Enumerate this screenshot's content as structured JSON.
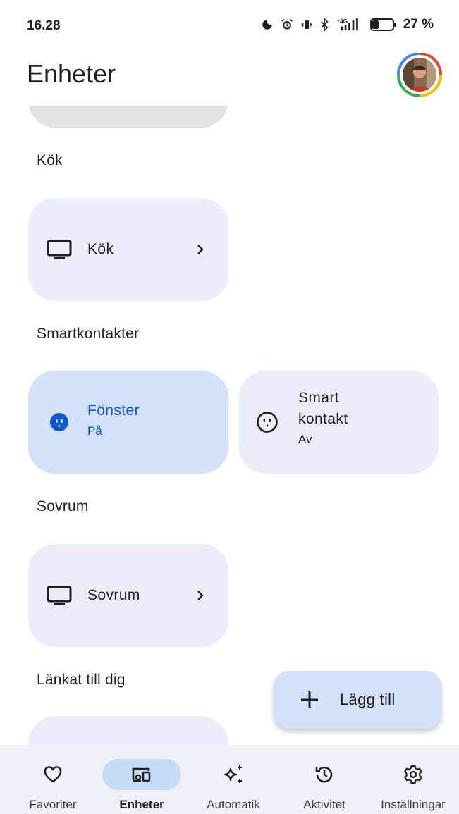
{
  "status_bar": {
    "time": "16.28",
    "battery_percent": "27 %",
    "icons": [
      "moon-icon",
      "alarm-icon",
      "vibrate-icon",
      "bluetooth-icon",
      "signal-4g-icon",
      "battery-icon"
    ]
  },
  "header": {
    "title": "Enheter"
  },
  "sections": {
    "kitchen": {
      "title": "Kök",
      "card_label": "Kök"
    },
    "smart_plugs": {
      "title": "Smartkontakter",
      "plug1_name": "Fönster",
      "plug1_state": "På",
      "plug2_name_line1": "Smart",
      "plug2_name_line2": "kontakt",
      "plug2_state": "Av"
    },
    "bedroom": {
      "title": "Sovrum",
      "card_label": "Sovrum"
    },
    "linked": {
      "title": "Länkat till dig"
    }
  },
  "fab": {
    "label": "Lägg till"
  },
  "nav": {
    "items": [
      {
        "label": "Favoriter",
        "icon": "heart-icon",
        "active": false
      },
      {
        "label": "Enheter",
        "icon": "devices-icon",
        "active": true
      },
      {
        "label": "Automatik",
        "icon": "sparkle-icon",
        "active": false
      },
      {
        "label": "Aktivitet",
        "icon": "history-icon",
        "active": false
      },
      {
        "label": "Inställningar",
        "icon": "gear-icon",
        "active": false
      }
    ]
  },
  "colors": {
    "accent": "#0b57d0",
    "card_bg": "#e9eef8",
    "card_active_bg": "#d3e1fb",
    "nav_bg": "#eef2f8",
    "nav_active_pill": "#c5dcf7"
  }
}
